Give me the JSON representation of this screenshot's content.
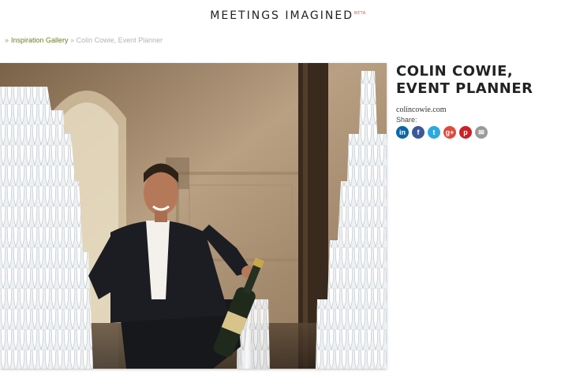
{
  "header": {
    "logo_text": "MEETINGS IMAGINED",
    "beta_label": "BETA"
  },
  "breadcrumb": {
    "separator": "»",
    "parent": "Inspiration Gallery",
    "current": "» Colin Cowie, Event Planner"
  },
  "article": {
    "title": "COLIN COWIE, EVENT PLANNER",
    "website": "colincowie.com",
    "share_label": "Share:"
  },
  "share_buttons": [
    {
      "name": "linkedin-icon",
      "glyph": "in",
      "color": "#0a66a8"
    },
    {
      "name": "facebook-icon",
      "glyph": "f",
      "color": "#3b5998"
    },
    {
      "name": "twitter-icon",
      "glyph": "t",
      "color": "#2aa9e0"
    },
    {
      "name": "google-plus-icon",
      "glyph": "g+",
      "color": "#dd4b39"
    },
    {
      "name": "pinterest-icon",
      "glyph": "p",
      "color": "#cb2027"
    },
    {
      "name": "email-icon",
      "glyph": "✉",
      "color": "#9a9a9a"
    }
  ],
  "colors": {
    "accent_link": "#6e7f20",
    "beta": "#e0503b"
  }
}
